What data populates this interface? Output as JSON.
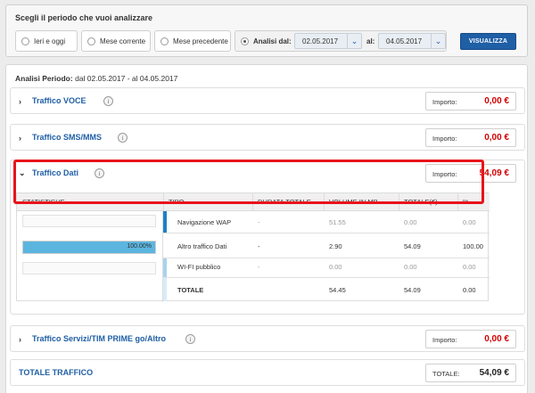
{
  "filter": {
    "title": "Scegli il periodo che vuoi analizzare",
    "options": [
      {
        "label": "Ieri e oggi",
        "selected": false
      },
      {
        "label": "Mese corrente",
        "selected": false
      },
      {
        "label": "Mese precedente",
        "selected": false
      }
    ],
    "range": {
      "label": "Analisi dal:",
      "from": "02.05.2017",
      "to_label": "al:",
      "to": "04.05.2017",
      "selected": true
    },
    "button": "VISUALIZZA"
  },
  "period": {
    "label": "Analisi Periodo:",
    "text": "dal 02.05.2017 - al 04.05.2017"
  },
  "sections": {
    "voce": {
      "title": "Traffico VOCE",
      "amount_label": "Importo:",
      "amount": "0,00 €"
    },
    "sms": {
      "title": "Traffico SMS/MMS",
      "amount_label": "Importo:",
      "amount": "0,00 €"
    },
    "dati": {
      "title": "Traffico Dati",
      "amount_label": "Importo:",
      "amount": "54,09 €"
    },
    "servizi": {
      "title": "Traffico Servizi/TIM PRIME go/Altro",
      "amount_label": "Importo:",
      "amount": "0,00 €"
    },
    "totale": {
      "title": "TOTALE TRAFFICO",
      "amount_label": "TOTALE:",
      "amount": "54,09 €"
    }
  },
  "table": {
    "headers": {
      "stats": "STATISTICHE",
      "tipo": "TIPO",
      "durata": "DURATA TOTALE",
      "volume": "VOLUME IN MB",
      "totale": "TOTALE(€)",
      "pct": "%"
    },
    "rows": [
      {
        "tipo": "Navigazione WAP",
        "durata": "-",
        "volume": "51.55",
        "totale": "0.00",
        "pct": "0.00",
        "color": "#1f7fc8"
      },
      {
        "tipo": "Altro traffico Dati",
        "durata": "-",
        "volume": "2.90",
        "totale": "54.09",
        "pct": "100.00",
        "color": "#ffffff"
      },
      {
        "tipo": "WI-FI pubblico",
        "durata": "-",
        "volume": "0.00",
        "totale": "0.00",
        "pct": "0.00",
        "color": "#a9d3ef"
      },
      {
        "tipo": "TOTALE",
        "durata": "-",
        "volume": "54.45",
        "totale": "54.09",
        "pct": "0.00",
        "color": "#d7ecf8"
      }
    ],
    "bar": {
      "label": "100.00%",
      "fraction": 1.0
    }
  }
}
